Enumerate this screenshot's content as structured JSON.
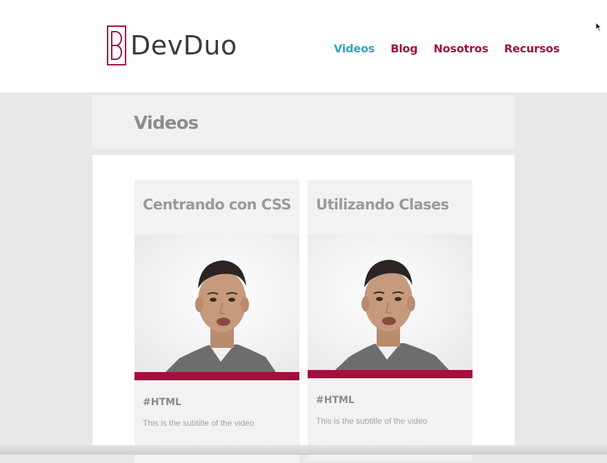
{
  "brand": {
    "name": "DevDuo",
    "accent": "#a3103c",
    "link_active": "#2aa8c1"
  },
  "nav": {
    "items": [
      {
        "label": "Videos",
        "active": true
      },
      {
        "label": "Blog",
        "active": false
      },
      {
        "label": "Nosotros",
        "active": false
      },
      {
        "label": "Recursos",
        "active": false
      }
    ]
  },
  "page": {
    "title": "Videos"
  },
  "videos": [
    {
      "title": "Centrando con CSS",
      "tag": "#HTML",
      "subtitle": "This is the subtitle of the video",
      "thumbnail_icon": "presenter-photo"
    },
    {
      "title": "Utilizando Clases",
      "tag": "#HTML",
      "subtitle": "This is the subtitle of the video",
      "thumbnail_icon": "presenter-photo"
    }
  ]
}
